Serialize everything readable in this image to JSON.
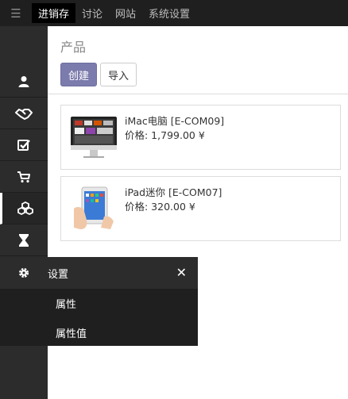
{
  "topbar": {
    "menu": [
      "进销存",
      "讨论",
      "网站",
      "系统设置"
    ]
  },
  "page": {
    "title": "产品",
    "create_label": "创建",
    "import_label": "导入"
  },
  "products": [
    {
      "name": "iMac电脑 [E-COM09]",
      "price": "价格: 1,799.00 ¥"
    },
    {
      "name": "iPad迷你 [E-COM07]",
      "price": "价格: 320.00 ¥"
    }
  ],
  "settings_menu": {
    "title": "设置",
    "items": [
      "属性",
      "属性值"
    ]
  },
  "icons": {
    "sidebar": [
      "user-icon",
      "handshake-icon",
      "checkbox-icon",
      "cart-icon",
      "cubes-icon",
      "hourglass-icon",
      "gear-icon"
    ]
  },
  "colors": {
    "primary": "#7c7bad",
    "topbar": "#1f1f1f",
    "sidebar": "#2c2c2c"
  }
}
